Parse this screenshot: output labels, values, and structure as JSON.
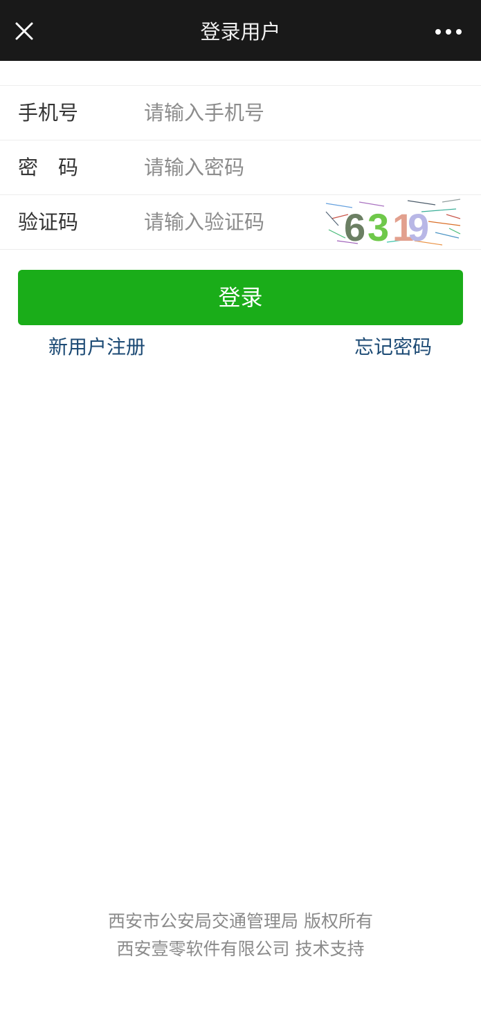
{
  "navbar": {
    "title": "登录用户",
    "close_icon": "close-icon",
    "more_icon": "more-dots-icon",
    "background": "#191919"
  },
  "form": {
    "phone": {
      "label": "手机号",
      "placeholder": "请输入手机号",
      "value": ""
    },
    "password": {
      "label": "密　码",
      "placeholder": "请输入密码",
      "value": ""
    },
    "captcha": {
      "label": "验证码",
      "placeholder": "请输入验证码",
      "value": "",
      "code": "6319"
    }
  },
  "actions": {
    "login_label": "登录",
    "login_color": "#1aad19",
    "register_label": "新用户注册",
    "forgot_label": "忘记密码",
    "link_color": "#1c4a74"
  },
  "footer": {
    "line1": "西安市公安局交通管理局 版权所有",
    "line2": "西安壹零软件有限公司 技术支持"
  }
}
